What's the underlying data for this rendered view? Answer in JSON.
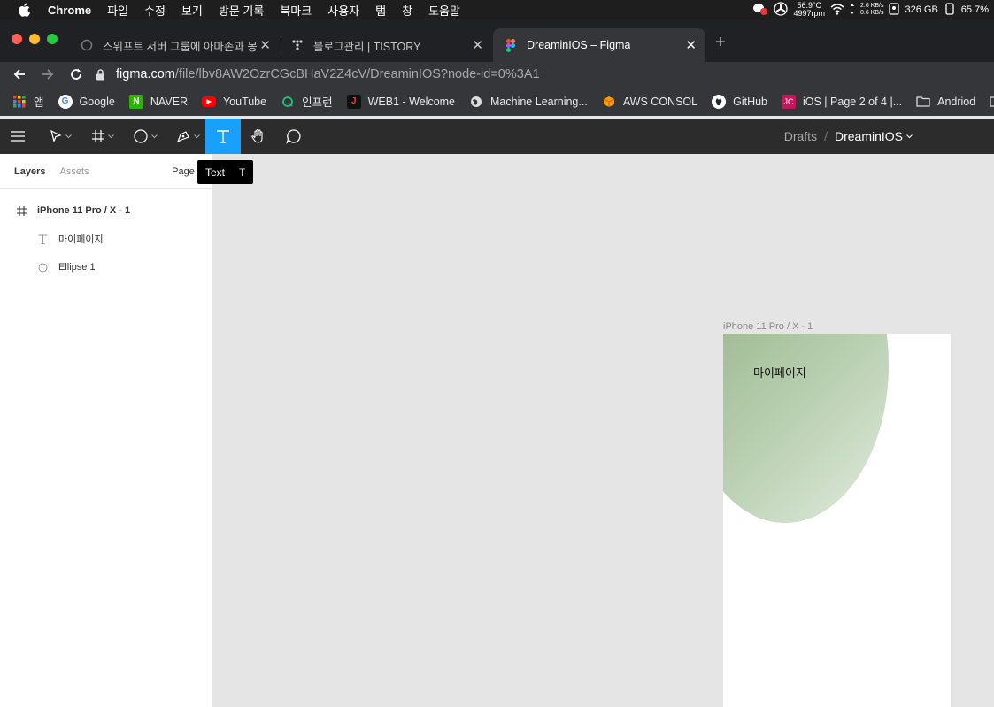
{
  "menubar": {
    "app": "Chrome",
    "items": [
      "파일",
      "수정",
      "보기",
      "방문 기록",
      "북마크",
      "사용자",
      "탭",
      "창",
      "도움말"
    ],
    "temp": "56.9°C",
    "rpm": "4997rpm",
    "net_up": "2.6 KB/s",
    "net_down": "0.6 KB/s",
    "disk": "326 GB",
    "battery": "65.7%"
  },
  "tabs": [
    {
      "title": "스위프트 서버 그룹에 아마존과 몽고DB"
    },
    {
      "title": "블로그관리 | TISTORY"
    },
    {
      "title": "DreaminIOS – Figma"
    }
  ],
  "omnibox": {
    "host": "figma.com",
    "path": "/file/lbv8AW2OzrCGcBHaV2Z4cV/DreaminIOS?node-id=0%3A1"
  },
  "bookmarks": [
    {
      "label": "앱"
    },
    {
      "label": "Google"
    },
    {
      "label": "NAVER"
    },
    {
      "label": "YouTube"
    },
    {
      "label": "인프런"
    },
    {
      "label": "WEB1 - Welcome"
    },
    {
      "label": "Machine Learning..."
    },
    {
      "label": "AWS CONSOL"
    },
    {
      "label": "GitHub"
    },
    {
      "label": "iOS | Page 2 of 4 |..."
    },
    {
      "label": "Andriod"
    }
  ],
  "figma": {
    "breadcrumb_drafts": "Drafts",
    "breadcrumb_file": "DreaminIOS",
    "tooltip_label": "Text",
    "tooltip_key": "T"
  },
  "left_panel": {
    "tab_layers": "Layers",
    "tab_assets": "Assets",
    "page": "Page 1",
    "layers": [
      {
        "name": "iPhone 11 Pro / X - 1"
      },
      {
        "name": "마이페이지"
      },
      {
        "name": "Ellipse 1"
      }
    ]
  },
  "canvas": {
    "frame_label": "iPhone 11 Pro / X - 1",
    "text_layer": "마이페이지"
  }
}
